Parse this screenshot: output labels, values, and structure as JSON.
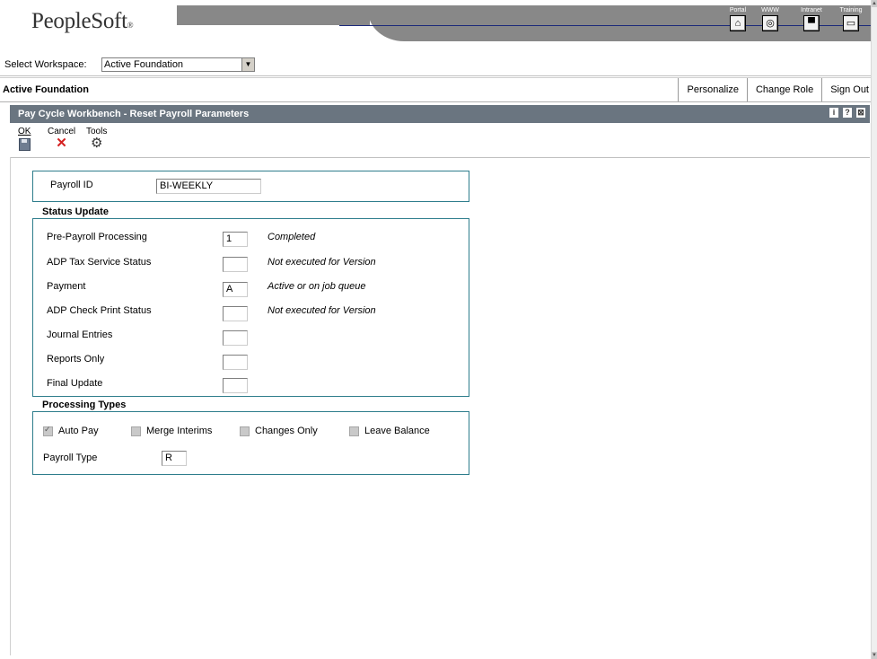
{
  "header": {
    "logo": "PeopleSoft",
    "logo_mark": "®",
    "portal_links": [
      {
        "label": "Portal",
        "icon": "home-icon",
        "glyph": "⌂"
      },
      {
        "label": "WWW",
        "icon": "globe-icon",
        "glyph": "◎"
      },
      {
        "label": "Intranet",
        "icon": "book-icon",
        "glyph": "▀"
      },
      {
        "label": "Training",
        "icon": "monitor-icon",
        "glyph": "▭"
      }
    ]
  },
  "workspace": {
    "label": "Select Workspace:",
    "selected": "Active Foundation",
    "arrow": "▼"
  },
  "role": {
    "title": "Active Foundation",
    "links": [
      "Personalize",
      "Change Role",
      "Sign Out"
    ]
  },
  "form": {
    "title": "Pay Cycle Workbench - Reset Payroll Parameters",
    "icons": [
      {
        "name": "info-icon",
        "glyph": "i"
      },
      {
        "name": "help-icon",
        "glyph": "?"
      },
      {
        "name": "minimize-icon",
        "glyph": "⊠"
      }
    ]
  },
  "toolbar": {
    "ok_label": "OK",
    "cancel_label": "Cancel",
    "tools_label": "Tools",
    "cancel_glyph": "✕",
    "tools_glyph": "⚙"
  },
  "payroll": {
    "id_label": "Payroll ID",
    "id_value": "BI-WEEKLY"
  },
  "status_update": {
    "title": "Status Update",
    "rows": [
      {
        "label": "Pre-Payroll Processing",
        "value": "1",
        "description": "Completed"
      },
      {
        "label": "ADP Tax Service Status",
        "value": "",
        "description": "Not executed for Version"
      },
      {
        "label": "Payment",
        "value": "A",
        "description": "Active or on job queue"
      },
      {
        "label": "ADP Check Print Status",
        "value": "",
        "description": "Not executed for Version"
      },
      {
        "label": "Journal Entries",
        "value": "",
        "description": ""
      },
      {
        "label": "Reports Only",
        "value": "",
        "description": ""
      },
      {
        "label": "Final Update",
        "value": "",
        "description": ""
      }
    ]
  },
  "processing_types": {
    "title": "Processing Types",
    "checkboxes": [
      {
        "label": "Auto Pay",
        "checked": true
      },
      {
        "label": "Merge Interims",
        "checked": false
      },
      {
        "label": "Changes Only",
        "checked": false
      },
      {
        "label": "Leave Balance",
        "checked": false
      }
    ],
    "payroll_type_label": "Payroll Type",
    "payroll_type_value": "R"
  },
  "scrollbar": {
    "up": "▲",
    "down": "▼"
  }
}
